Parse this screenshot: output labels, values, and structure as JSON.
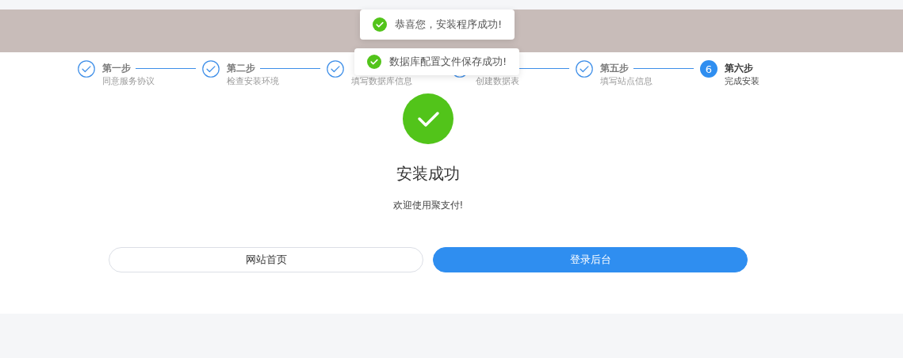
{
  "toasts": [
    {
      "message": "恭喜您，安装程序成功!"
    },
    {
      "message": "数据库配置文件保存成功!"
    }
  ],
  "steps": [
    {
      "title": "第一步",
      "description": "同意服务协议",
      "done": true
    },
    {
      "title": "第二步",
      "description": "检查安装环境",
      "done": true
    },
    {
      "description": "填写数据库信息",
      "done": true
    },
    {
      "description": "创建数据表",
      "done": true
    },
    {
      "title": "第五步",
      "description": "填写站点信息",
      "done": true
    },
    {
      "number": "6",
      "title": "第六步",
      "description": "完成安装",
      "done": false
    }
  ],
  "result": {
    "title": "安装成功",
    "message": "欢迎使用聚支付!"
  },
  "buttons": [
    {
      "label": "网站首页",
      "kind": "secondary"
    },
    {
      "label": "登录后台",
      "kind": "primary"
    }
  ]
}
